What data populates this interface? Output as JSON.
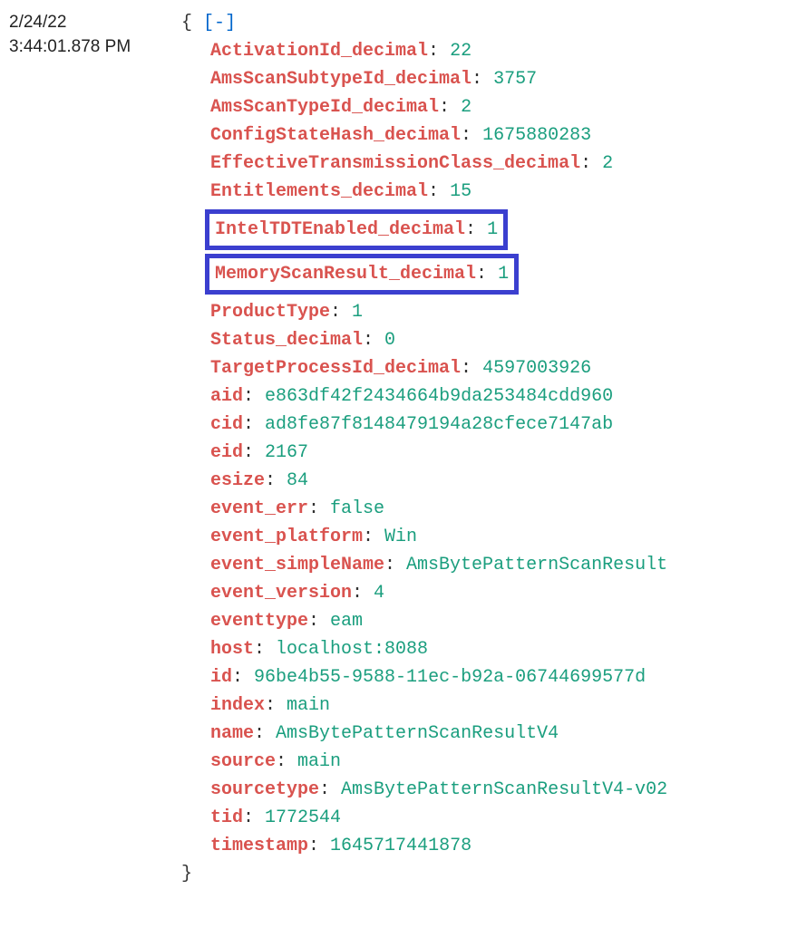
{
  "timestamp": {
    "date": "2/24/22",
    "time": "3:44:01.878 PM"
  },
  "json": {
    "open_brace": "{",
    "close_brace": "}",
    "collapse_open": "[",
    "collapse_dash": "-",
    "collapse_close": "]",
    "fields": [
      {
        "key": "ActivationId_decimal",
        "value": "22",
        "highlight": false
      },
      {
        "key": "AmsScanSubtypeId_decimal",
        "value": "3757",
        "highlight": false
      },
      {
        "key": "AmsScanTypeId_decimal",
        "value": "2",
        "highlight": false
      },
      {
        "key": "ConfigStateHash_decimal",
        "value": "1675880283",
        "highlight": false
      },
      {
        "key": "EffectiveTransmissionClass_decimal",
        "value": "2",
        "highlight": false
      },
      {
        "key": "Entitlements_decimal",
        "value": "15",
        "highlight": false
      },
      {
        "key": "IntelTDTEnabled_decimal",
        "value": "1",
        "highlight": true
      },
      {
        "key": "MemoryScanResult_decimal",
        "value": "1",
        "highlight": true
      },
      {
        "key": "ProductType",
        "value": "1",
        "highlight": false
      },
      {
        "key": "Status_decimal",
        "value": "0",
        "highlight": false
      },
      {
        "key": "TargetProcessId_decimal",
        "value": "4597003926",
        "highlight": false
      },
      {
        "key": "aid",
        "value": "e863df42f2434664b9da253484cdd960",
        "highlight": false
      },
      {
        "key": "cid",
        "value": "ad8fe87f8148479194a28cfece7147ab",
        "highlight": false
      },
      {
        "key": "eid",
        "value": "2167",
        "highlight": false
      },
      {
        "key": "esize",
        "value": "84",
        "highlight": false
      },
      {
        "key": "event_err",
        "value": "false",
        "highlight": false
      },
      {
        "key": "event_platform",
        "value": "Win",
        "highlight": false
      },
      {
        "key": "event_simpleName",
        "value": "AmsBytePatternScanResult",
        "highlight": false
      },
      {
        "key": "event_version",
        "value": "4",
        "highlight": false
      },
      {
        "key": "eventtype",
        "value": "eam",
        "highlight": false
      },
      {
        "key": "host",
        "value": "localhost:8088",
        "highlight": false
      },
      {
        "key": "id",
        "value": "96be4b55-9588-11ec-b92a-06744699577d",
        "highlight": false
      },
      {
        "key": "index",
        "value": "main",
        "highlight": false
      },
      {
        "key": "name",
        "value": "AmsBytePatternScanResultV4",
        "highlight": false
      },
      {
        "key": "source",
        "value": "main",
        "highlight": false
      },
      {
        "key": "sourcetype",
        "value": "AmsBytePatternScanResultV4-v02",
        "highlight": false
      },
      {
        "key": "tid",
        "value": "1772544",
        "highlight": false
      },
      {
        "key": "timestamp",
        "value": "1645717441878",
        "highlight": false
      }
    ]
  }
}
